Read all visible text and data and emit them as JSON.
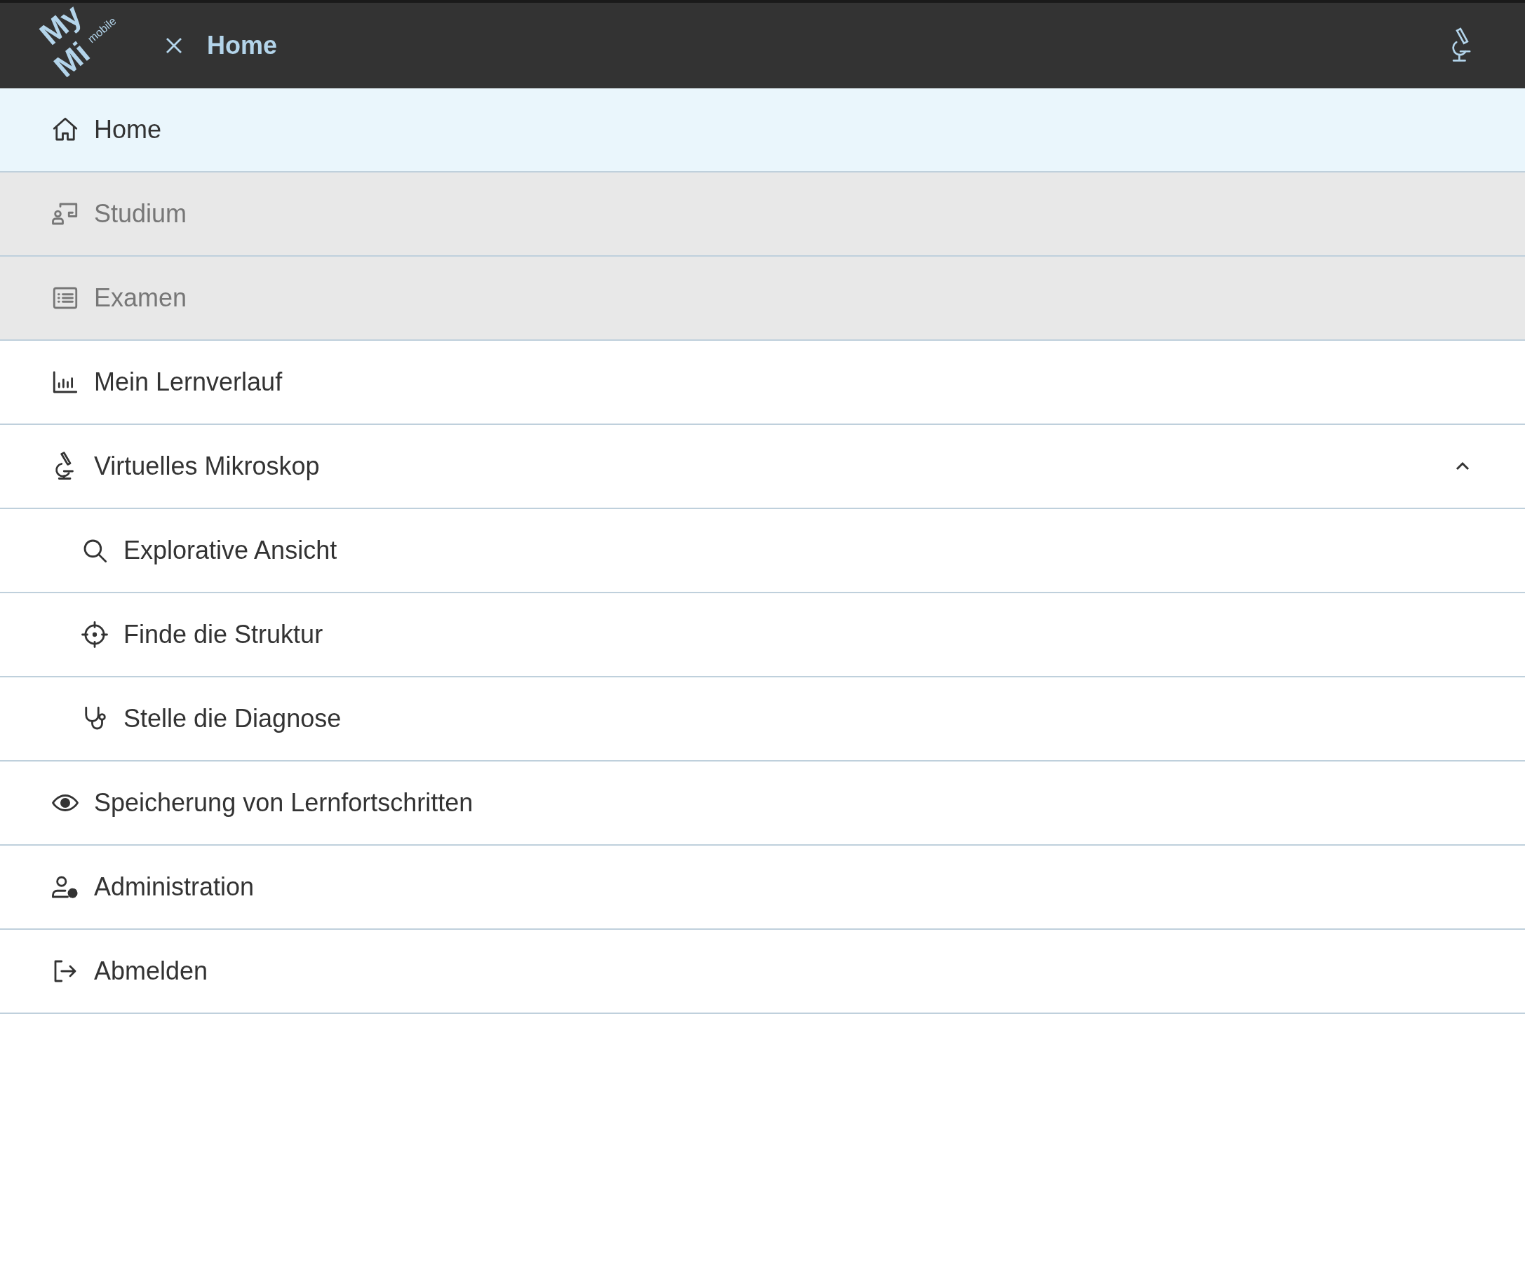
{
  "header": {
    "logo": {
      "line1": "My",
      "line2": "Mi",
      "tagline": "mobile"
    },
    "title": "Home"
  },
  "menu": [
    {
      "label": "Home",
      "selected": true,
      "disabled": false
    },
    {
      "label": "Studium",
      "selected": false,
      "disabled": true
    },
    {
      "label": "Examen",
      "selected": false,
      "disabled": true
    },
    {
      "label": "Mein Lernverlauf",
      "selected": false,
      "disabled": false
    },
    {
      "label": "Virtuelles Mikroskop",
      "selected": false,
      "disabled": false,
      "expanded": true,
      "children": [
        {
          "label": "Explorative Ansicht",
          "selected": false
        },
        {
          "label": "Finde die Struktur",
          "selected": false
        },
        {
          "label": "Stelle die Diagnose",
          "selected": false
        }
      ]
    },
    {
      "label": "Speicherung von Lernfortschritten",
      "selected": false,
      "disabled": false
    },
    {
      "label": "Administration",
      "selected": false,
      "disabled": false
    },
    {
      "label": "Abmelden",
      "selected": false,
      "disabled": false
    }
  ]
}
